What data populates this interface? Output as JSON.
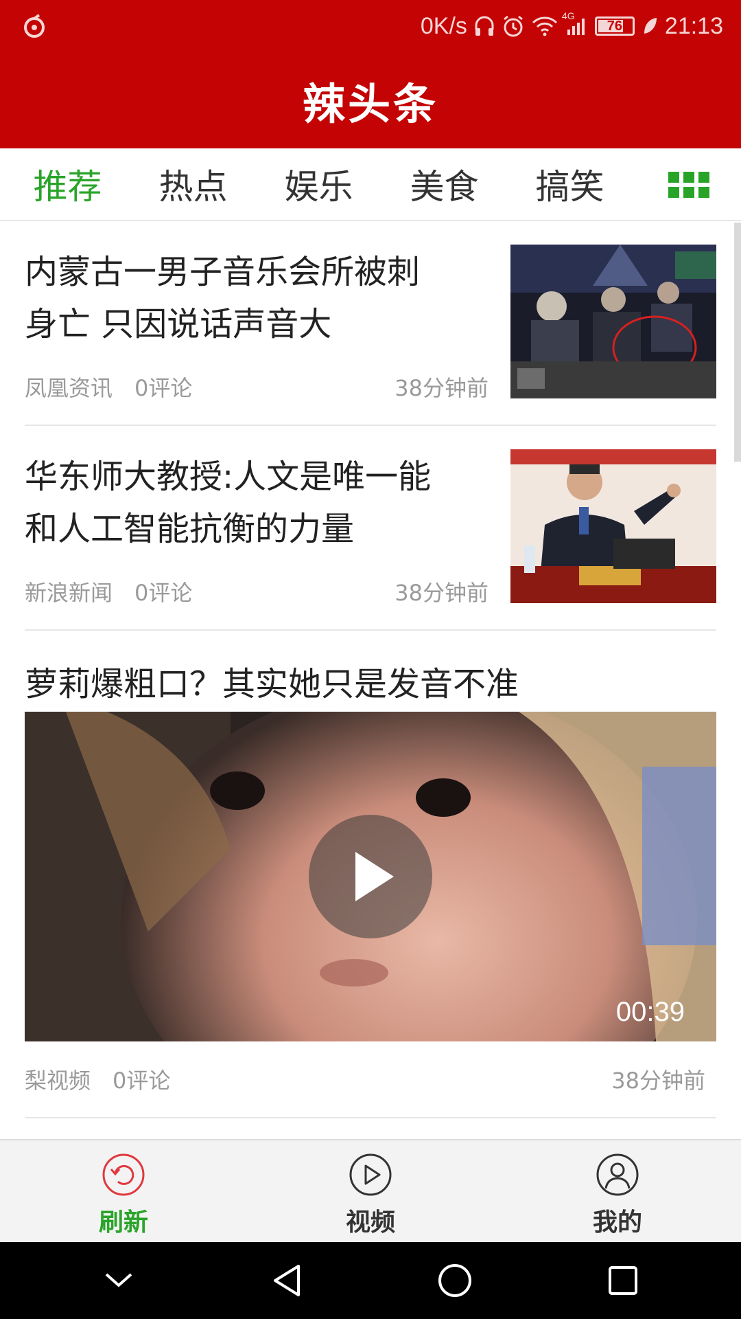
{
  "status_bar": {
    "speed": "0K/s",
    "network": "4G",
    "battery": "76",
    "time": "21:13"
  },
  "app_title": "辣头条",
  "tabs": [
    {
      "label": "推荐",
      "active": true
    },
    {
      "label": "热点",
      "active": false
    },
    {
      "label": "娱乐",
      "active": false
    },
    {
      "label": "美食",
      "active": false
    },
    {
      "label": "搞笑",
      "active": false
    }
  ],
  "feed": [
    {
      "title_line1": "内蒙古一男子音乐会所被刺",
      "title_line2": "身亡 只因说话声音大",
      "source": "凤凰资讯",
      "comments": "0评论",
      "time": "38分钟前"
    },
    {
      "title_line1": "华东师大教授:人文是唯一能",
      "title_line2": "和人工智能抗衡的力量",
      "source": "新浪新闻",
      "comments": "0评论",
      "time": "38分钟前"
    },
    {
      "title": "萝莉爆粗口？其实她只是发音不准",
      "duration": "00:39",
      "source": "梨视频",
      "comments": "0评论",
      "time": "38分钟前"
    }
  ],
  "bottom_nav": [
    {
      "label": "刷新",
      "icon": "refresh-icon",
      "active": true
    },
    {
      "label": "视频",
      "icon": "play-circle-icon",
      "active": false
    },
    {
      "label": "我的",
      "icon": "user-icon",
      "active": false
    }
  ],
  "colors": {
    "brand_red": "#c40404",
    "active_green": "#2aa42a",
    "refresh_red": "#e0393e"
  }
}
